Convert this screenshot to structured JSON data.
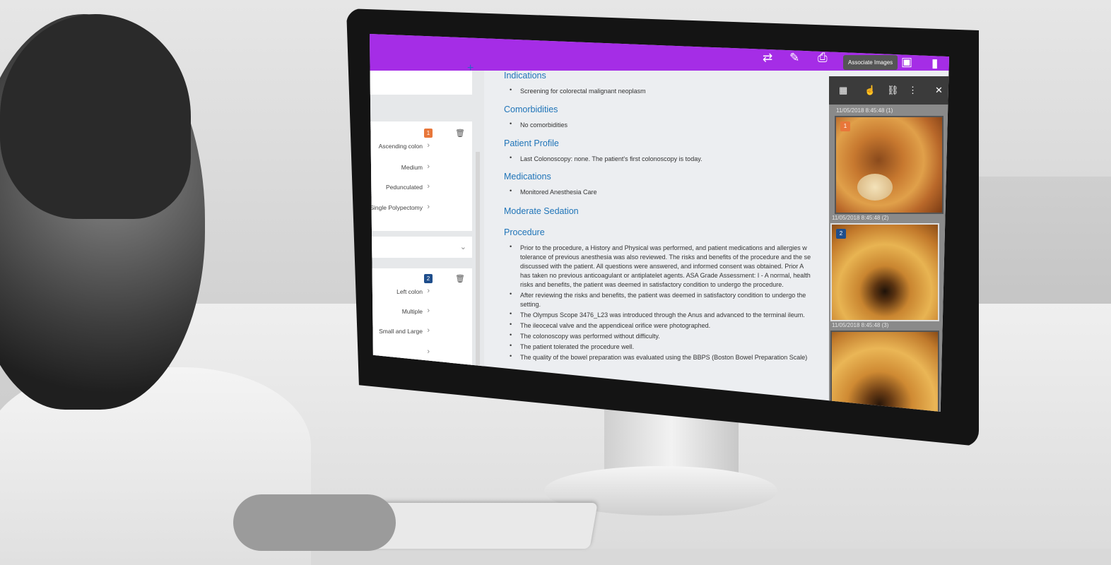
{
  "toolbar": {
    "tooltip": "Associate Images",
    "icons": [
      "swap-icon",
      "edit-icon",
      "print-icon",
      "image-icon",
      "bookmark-icon"
    ]
  },
  "left_panel": {
    "finding1": {
      "badge": "1",
      "rows": [
        "Ascending colon",
        "Medium",
        "Pedunculated",
        "Single Polypectomy"
      ]
    },
    "finding2": {
      "badge": "2",
      "rows": [
        "Left colon",
        "Multiple",
        "Small and Large",
        ""
      ]
    }
  },
  "report": {
    "indications_title": "Indications",
    "indications": [
      "Screening for colorectal malignant neoplasm"
    ],
    "comorbidities_title": "Comorbidities",
    "comorbidities": [
      "No comorbidities"
    ],
    "patient_profile_title": "Patient Profile",
    "patient_profile": [
      "Last Colonoscopy: none. The patient's first colonoscopy is today."
    ],
    "medications_title": "Medications",
    "medications": [
      "Monitored Anesthesia Care"
    ],
    "sedation_title": "Moderate Sedation",
    "procedure_title": "Procedure",
    "procedure_lines": [
      "Prior to the procedure, a History and Physical was performed, and patient medications and allergies w",
      "tolerance of previous anesthesia was also reviewed.  The risks and benefits of the procedure and the se",
      "discussed with the patient.  All questions were answered, and informed consent was obtained.  Prior A",
      "has taken no previous anticoagulant or antiplatelet agents. ASA Grade Assessment: I - A normal, health",
      "risks and benefits, the patient was deemed in satisfactory condition to undergo the procedure.",
      "After reviewing the risks and benefits, the patient was deemed in satisfactory condition to undergo the",
      "setting.",
      "The Olympus Scope 3476_L23 was introduced through the Anus and advanced to the terminal ileum.",
      "The ileocecal valve and the appendiceal orifice were photographed.",
      "The colonoscopy was performed without difficulty.",
      "The patient tolerated the procedure well.",
      "The quality of the bowel preparation was evaluated using the BBPS (Boston Bowel Preparation Scale)"
    ]
  },
  "images": [
    {
      "stamp": "11/05/2018 8:45:48 (1)",
      "badge": "1"
    },
    {
      "stamp": "11/05/2018 8:45:48 (2)",
      "badge": "2"
    },
    {
      "stamp": "11/05/2018 8:45:48 (3)",
      "badge": ""
    }
  ],
  "colors": {
    "topbar": "#a52de6",
    "accent": "#1f74b8",
    "badge_orange": "#e8773a",
    "badge_blue": "#1f4e8c"
  }
}
